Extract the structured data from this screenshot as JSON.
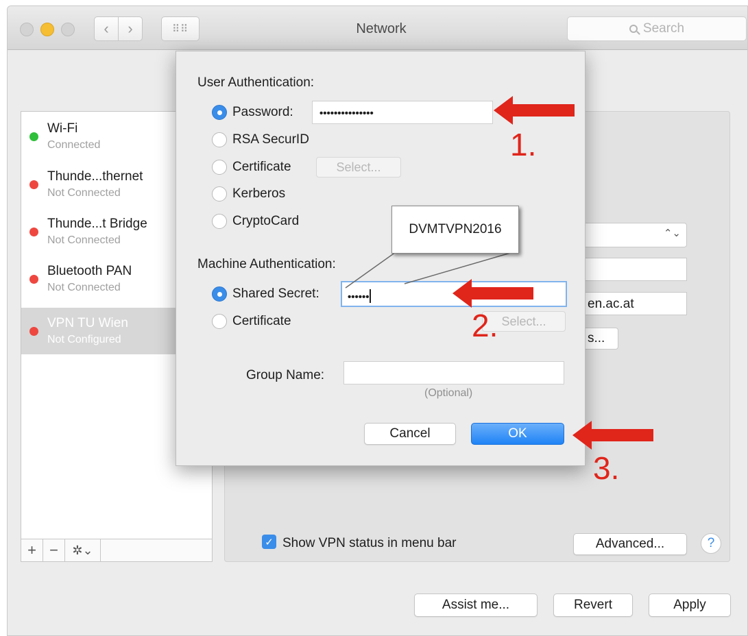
{
  "window": {
    "title": "Network",
    "search_placeholder": "Search",
    "nav_back": "‹",
    "nav_forward": "›",
    "grid_glyph": "⠿⠿"
  },
  "sidebar": {
    "services": [
      {
        "name": "Wi-Fi",
        "status": "Connected",
        "color": "#2fbf3a"
      },
      {
        "name": "Thunde...thernet",
        "status": "Not Connected",
        "color": "#ee4740"
      },
      {
        "name": "Thunde...t Bridge",
        "status": "Not Connected",
        "color": "#ee4740"
      },
      {
        "name": "Bluetooth PAN",
        "status": "Not Connected",
        "color": "#ee4740"
      },
      {
        "name": "VPN TU Wien",
        "status": "Not Configured",
        "color": "#ee4740"
      }
    ],
    "tools": {
      "add": "+",
      "remove": "−",
      "gear": "✲⌄"
    }
  },
  "main": {
    "server_partial": "en.ac.at",
    "button_partial": "s...",
    "select_arrows": "⌃⌄",
    "show_vpn_label": "Show VPN status in menu bar",
    "checkmark": "✓",
    "advanced_label": "Advanced...",
    "help_label": "?",
    "assist_label": "Assist me...",
    "revert_label": "Revert",
    "apply_label": "Apply"
  },
  "sheet": {
    "user_auth_title": "User Authentication:",
    "password_label": "Password:",
    "password_value": "•••••••••••••••",
    "rsa_label": "RSA SecurID",
    "certificate_label": "Certificate",
    "select_label": "Select...",
    "kerberos_label": "Kerberos",
    "cryptocard_label": "CryptoCard",
    "machine_auth_title": "Machine Authentication:",
    "shared_secret_label": "Shared Secret:",
    "shared_secret_value": "••••••",
    "machine_certificate_label": "Certificate",
    "machine_select_label": "Select...",
    "group_name_label": "Group Name:",
    "optional_label": "(Optional)",
    "cancel_label": "Cancel",
    "ok_label": "OK"
  },
  "annotations": {
    "callout_text": "DVMTVPN2016",
    "step1": "1.",
    "step2": "2.",
    "step3": "3.",
    "arrow_color": "#e0251b"
  }
}
